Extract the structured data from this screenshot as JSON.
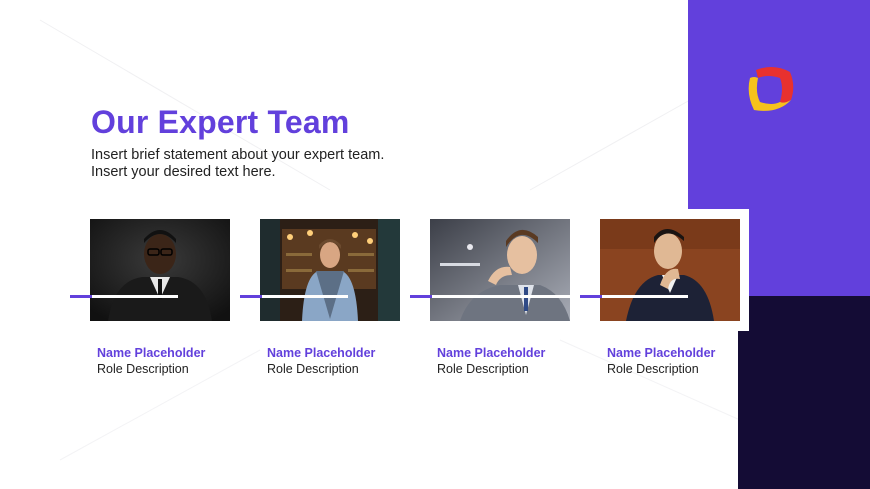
{
  "slide": {
    "title": "Our Expert Team",
    "subtitle_lines": [
      "Insert brief statement about your expert team.",
      "Insert your desired text here."
    ]
  },
  "team": [
    {
      "name": "Name Placeholder",
      "role": "Role Description"
    },
    {
      "name": "Name Placeholder",
      "role": "Role Description"
    },
    {
      "name": "Name Placeholder",
      "role": "Role Description"
    },
    {
      "name": "Name Placeholder",
      "role": "Role Description"
    }
  ],
  "colors": {
    "accent_purple": "#6240dc",
    "dark_navy": "#140c35",
    "logo_red": "#e8312f",
    "logo_yellow": "#f6c21c"
  }
}
